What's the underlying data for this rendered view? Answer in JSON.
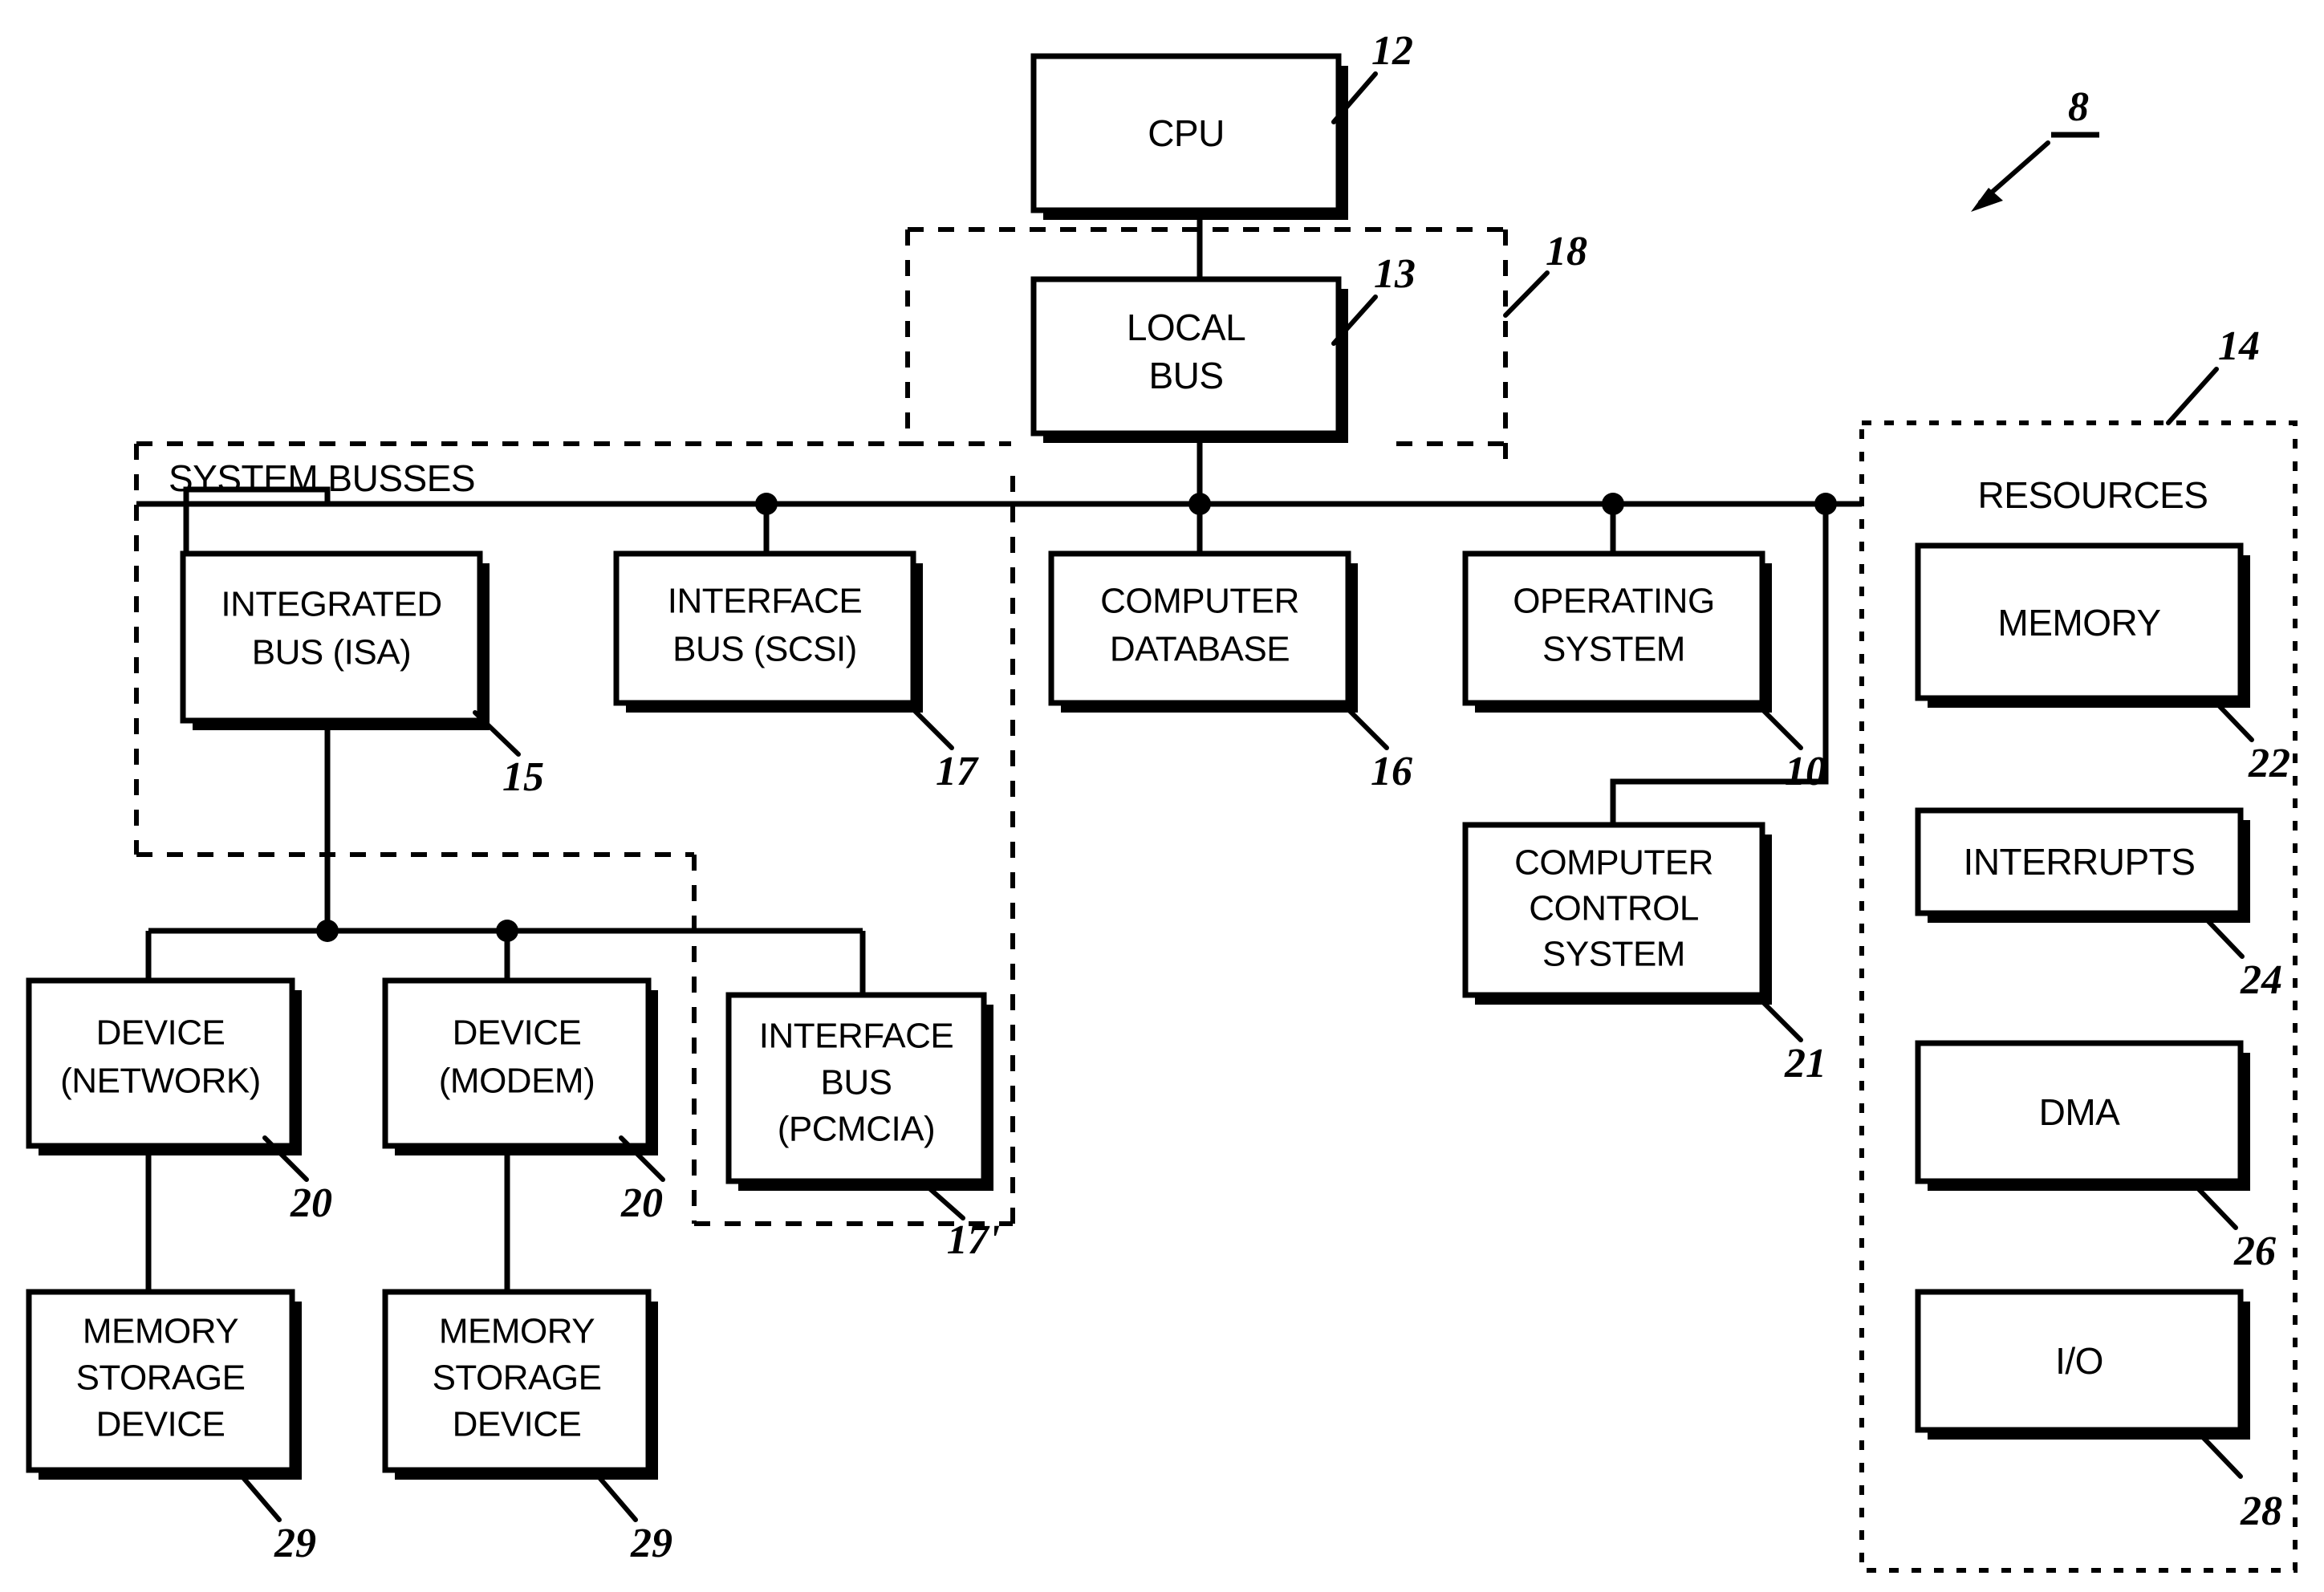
{
  "figure": {
    "figure_ref": "8",
    "groups": [
      {
        "id": "system-busses",
        "title": "SYSTEM BUSSES"
      },
      {
        "id": "resources",
        "title": "RESOURCES"
      }
    ],
    "blocks": [
      {
        "id": "cpu",
        "lines": [
          "CPU"
        ],
        "ref": "12"
      },
      {
        "id": "local-bus",
        "lines": [
          "LOCAL",
          "BUS"
        ],
        "ref": "13"
      },
      {
        "id": "integrated-bus-isa",
        "lines": [
          "INTEGRATED",
          "BUS (ISA)"
        ],
        "ref": "15"
      },
      {
        "id": "interface-bus-scsi",
        "lines": [
          "INTERFACE",
          "BUS (SCSI)"
        ],
        "ref": "17"
      },
      {
        "id": "computer-database",
        "lines": [
          "COMPUTER",
          "DATABASE"
        ],
        "ref": "16"
      },
      {
        "id": "operating-system",
        "lines": [
          "OPERATING",
          "SYSTEM"
        ],
        "ref": "10"
      },
      {
        "id": "computer-control-system",
        "lines": [
          "COMPUTER",
          "CONTROL",
          "SYSTEM"
        ],
        "ref": "21"
      },
      {
        "id": "device-network",
        "lines": [
          "DEVICE",
          "(NETWORK)"
        ],
        "ref": "20"
      },
      {
        "id": "device-modem",
        "lines": [
          "DEVICE",
          "(MODEM)"
        ],
        "ref": "20"
      },
      {
        "id": "interface-bus-pcmcia",
        "lines": [
          "INTERFACE",
          "BUS",
          "(PCMCIA)"
        ],
        "ref": "17'"
      },
      {
        "id": "memory-storage-device-1",
        "lines": [
          "MEMORY",
          "STORAGE",
          "DEVICE"
        ],
        "ref": "29"
      },
      {
        "id": "memory-storage-device-2",
        "lines": [
          "MEMORY",
          "STORAGE",
          "DEVICE"
        ],
        "ref": "29"
      },
      {
        "id": "memory",
        "lines": [
          "MEMORY"
        ],
        "ref": "22"
      },
      {
        "id": "interrupts",
        "lines": [
          "INTERRUPTS"
        ],
        "ref": "24"
      },
      {
        "id": "dma",
        "lines": [
          "DMA"
        ],
        "ref": "26"
      },
      {
        "id": "io",
        "lines": [
          "I/O"
        ],
        "ref": "28"
      }
    ],
    "group_refs": [
      {
        "id": "local-bus-group-ref",
        "ref": "18"
      },
      {
        "id": "resources-group-ref",
        "ref": "14"
      }
    ],
    "colors": {
      "ink": "#000000",
      "paper": "#ffffff"
    }
  }
}
